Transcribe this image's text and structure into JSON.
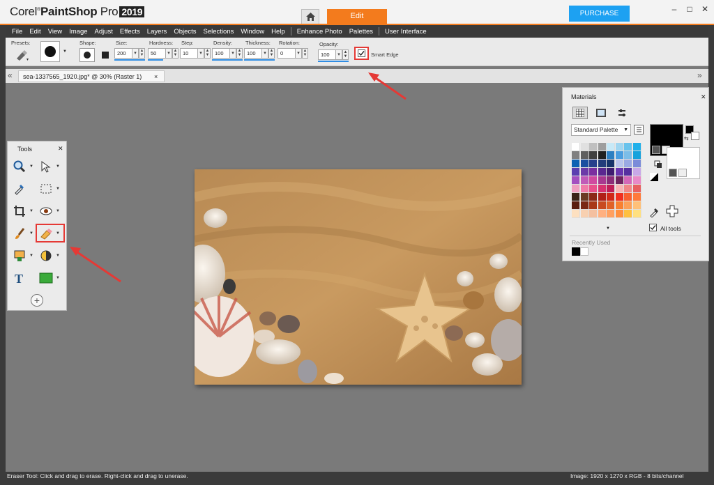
{
  "app": {
    "logo_prefix": "Corel",
    "logo_name": "PaintShop",
    "logo_suffix": "Pro",
    "year": "2019",
    "tabs": [
      {
        "label": "Edit"
      }
    ],
    "purchase_label": "PURCHASE",
    "window_controls": [
      "–",
      "□",
      "✕"
    ]
  },
  "menu": [
    "File",
    "Edit",
    "View",
    "Image",
    "Adjust",
    "Effects",
    "Layers",
    "Objects",
    "Selections",
    "Window",
    "Help",
    "Enhance Photo",
    "Palettes",
    "User Interface"
  ],
  "tool_options": {
    "presets_label": "Presets:",
    "shape_label": "Shape:",
    "size_label": "Size:",
    "size_value": "200",
    "hardness_label": "Hardness:",
    "hardness_value": "50",
    "step_label": "Step:",
    "step_value": "10",
    "density_label": "Density:",
    "density_value": "100",
    "thickness_label": "Thickness:",
    "thickness_value": "100",
    "rotation_label": "Rotation:",
    "rotation_value": "0",
    "opacity_label": "Opacity:",
    "opacity_value": "100",
    "smart_edge_label": "Smart Edge",
    "smart_edge_checked": true
  },
  "document_tab": {
    "title": "sea-1337565_1920.jpg* @  30% (Raster 1)",
    "close": "×"
  },
  "tools_palette": {
    "title": "Tools",
    "close": "✕",
    "tools": [
      "zoom-tool",
      "pick-tool",
      "dropper-tool",
      "selection-tool",
      "crop-tool",
      "red-eye-tool",
      "paint-brush-tool",
      "eraser-tool",
      "clone-tool",
      "dodge-tool",
      "text-tool",
      "rectangle-tool"
    ],
    "add_label": "+"
  },
  "materials": {
    "title": "Materials",
    "close": "✕",
    "palette_select": "Standard Palette",
    "all_tools_label": "All tools",
    "all_tools_checked": true,
    "recently_used_label": "Recently Used",
    "foreground_color": "#000000",
    "background_color": "#ffffff"
  },
  "status": {
    "hint": "Eraser Tool: Click and drag to erase. Right-click and drag to unerase.",
    "image_info": "Image:  1920 x 1270 x RGB - 8 bits/channel"
  },
  "colors": {
    "accent_orange": "#f37b1d",
    "purchase_blue": "#1da1f2",
    "annotation_red": "#e53935"
  }
}
